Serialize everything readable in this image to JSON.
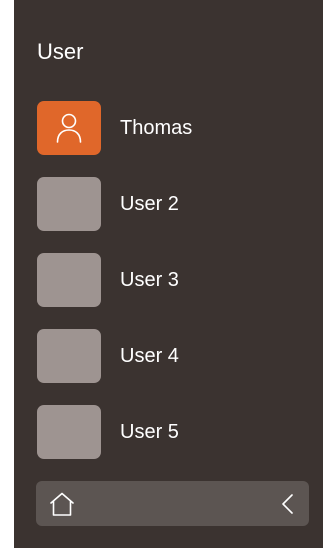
{
  "header": {
    "title": "User"
  },
  "users": [
    {
      "name": "Thomas",
      "active": true,
      "icon": "person-icon"
    },
    {
      "name": "User 2",
      "active": false
    },
    {
      "name": "User 3",
      "active": false
    },
    {
      "name": "User 4",
      "active": false
    },
    {
      "name": "User 5",
      "active": false
    }
  ],
  "nav": {
    "home_icon": "home-icon",
    "back_icon": "chevron-left-icon"
  },
  "colors": {
    "panel_background": "#3b3330",
    "active_tile": "#e0672a",
    "inactive_tile": "#9e9491",
    "nav_bar": "#5c5552",
    "text": "#ffffff"
  }
}
